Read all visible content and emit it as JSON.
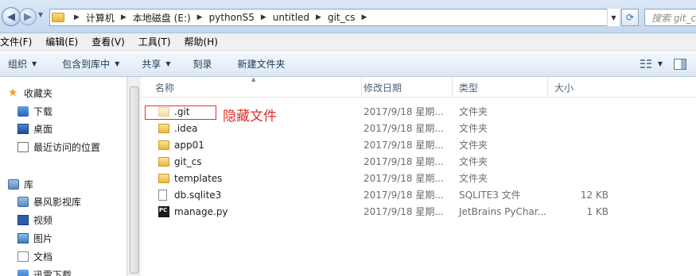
{
  "address_bar": {
    "crumbs": [
      "计算机",
      "本地磁盘 (E:)",
      "pythonS5",
      "untitled",
      "git_cs"
    ],
    "search_placeholder": "搜索 git_cs"
  },
  "menu": [
    "文件(F)",
    "编辑(E)",
    "查看(V)",
    "工具(T)",
    "帮助(H)"
  ],
  "toolbar": {
    "organize": "组织",
    "include_library": "包含到库中",
    "share": "共享",
    "burn": "刻录",
    "new_folder": "新建文件夹"
  },
  "navpane": {
    "favorites": {
      "label": "收藏夹",
      "items": [
        "下载",
        "桌面",
        "最近访问的位置"
      ]
    },
    "libraries": {
      "label": "库",
      "items": [
        "暴风影视库",
        "视频",
        "图片",
        "文档",
        "迅雷下载"
      ]
    }
  },
  "columns": [
    "名称",
    "修改日期",
    "类型",
    "大小"
  ],
  "files": [
    {
      "name": ".git",
      "date": "2017/9/18 星期...",
      "type": "文件夹",
      "size": "",
      "icon": "folder-hidden-icon"
    },
    {
      "name": ".idea",
      "date": "2017/9/18 星期...",
      "type": "文件夹",
      "size": "",
      "icon": "folder-icon"
    },
    {
      "name": "app01",
      "date": "2017/9/18 星期...",
      "type": "文件夹",
      "size": "",
      "icon": "folder-icon"
    },
    {
      "name": "git_cs",
      "date": "2017/9/18 星期...",
      "type": "文件夹",
      "size": "",
      "icon": "folder-icon"
    },
    {
      "name": "templates",
      "date": "2017/9/18 星期...",
      "type": "文件夹",
      "size": "",
      "icon": "folder-icon"
    },
    {
      "name": "db.sqlite3",
      "date": "2017/9/18 星期...",
      "type": "SQLITE3 文件",
      "size": "12 KB",
      "icon": "file-icon"
    },
    {
      "name": "manage.py",
      "date": "2017/9/18 星期...",
      "type": "JetBrains PyChar...",
      "size": "1 KB",
      "icon": "pycharm-file-icon"
    }
  ],
  "annotation": "隐藏文件",
  "colors": {
    "annotation_red": "#e0302a",
    "toolbar_text": "#1e3954"
  }
}
